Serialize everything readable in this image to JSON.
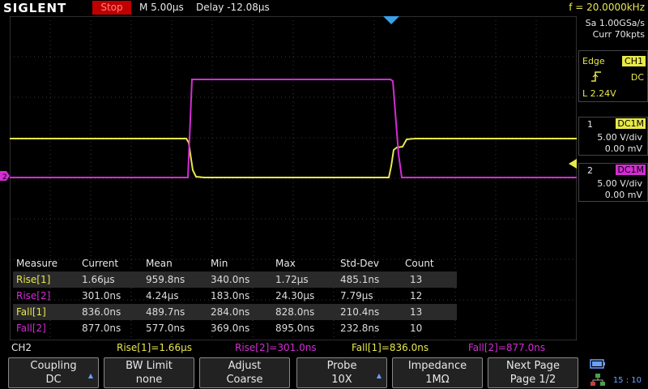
{
  "header": {
    "logo": "SIGLENT",
    "run_state": "Stop",
    "timebase": "M 5.00μs",
    "delay": "Delay -12.08μs",
    "frequency": "f = 20.0000kHz"
  },
  "acquisition": {
    "sample_rate": "Sa 1.00GSa/s",
    "memory": "Curr 70kpts"
  },
  "trigger": {
    "type": "Edge",
    "source": "CH1",
    "coupling": "DC",
    "slope_icon": "rising-edge-icon",
    "level": "L  2.24V"
  },
  "channels": [
    {
      "num": "1",
      "coupling": "DC1M",
      "vdiv": "5.00 V/div",
      "offset": "0.00 mV",
      "color": "#e8e84a"
    },
    {
      "num": "2",
      "coupling": "DC1M",
      "vdiv": "5.00 V/div",
      "offset": "0.00 mV",
      "color": "#d42cd4"
    }
  ],
  "measure": {
    "headers": [
      "Measure",
      "Current",
      "Mean",
      "Min",
      "Max",
      "Std-Dev",
      "Count"
    ],
    "rows": [
      {
        "name": "Rise[1]",
        "current": "1.66μs",
        "mean": "959.8ns",
        "min": "340.0ns",
        "max": "1.72μs",
        "std": "485.1ns",
        "count": "13"
      },
      {
        "name": "Rise[2]",
        "current": "301.0ns",
        "mean": "4.24μs",
        "min": "183.0ns",
        "max": "24.30μs",
        "std": "7.79μs",
        "count": "12"
      },
      {
        "name": "Fall[1]",
        "current": "836.0ns",
        "mean": "489.7ns",
        "min": "284.0ns",
        "max": "828.0ns",
        "std": "210.4ns",
        "count": "13"
      },
      {
        "name": "Fall[2]",
        "current": "877.0ns",
        "mean": "577.0ns",
        "min": "369.0ns",
        "max": "895.0ns",
        "std": "232.8ns",
        "count": "10"
      }
    ]
  },
  "status": {
    "channel": "CH2",
    "items": [
      "Rise[1]=1.66μs",
      "Rise[2]=301.0ns",
      "Fall[1]=836.0ns",
      "Fall[2]=877.0ns"
    ]
  },
  "softkeys": [
    {
      "line1": "Coupling",
      "line2": "DC",
      "arrow": "▲▼"
    },
    {
      "line1": "BW Limit",
      "line2": "none",
      "arrow": ""
    },
    {
      "line1": "Adjust",
      "line2": "Coarse",
      "arrow": ""
    },
    {
      "line1": "Probe",
      "line2": "10X",
      "arrow": "▲▼"
    },
    {
      "line1": "Impedance",
      "line2": "1MΩ",
      "arrow": ""
    },
    {
      "line1": "Next Page",
      "line2": "Page 1/2",
      "arrow": ""
    }
  ],
  "clock": "15 : 10",
  "colors": {
    "ch1": "#e8e84a",
    "ch2": "#d42cd4",
    "grid": "#3a3a3a",
    "accent": "#6aa0ff"
  }
}
